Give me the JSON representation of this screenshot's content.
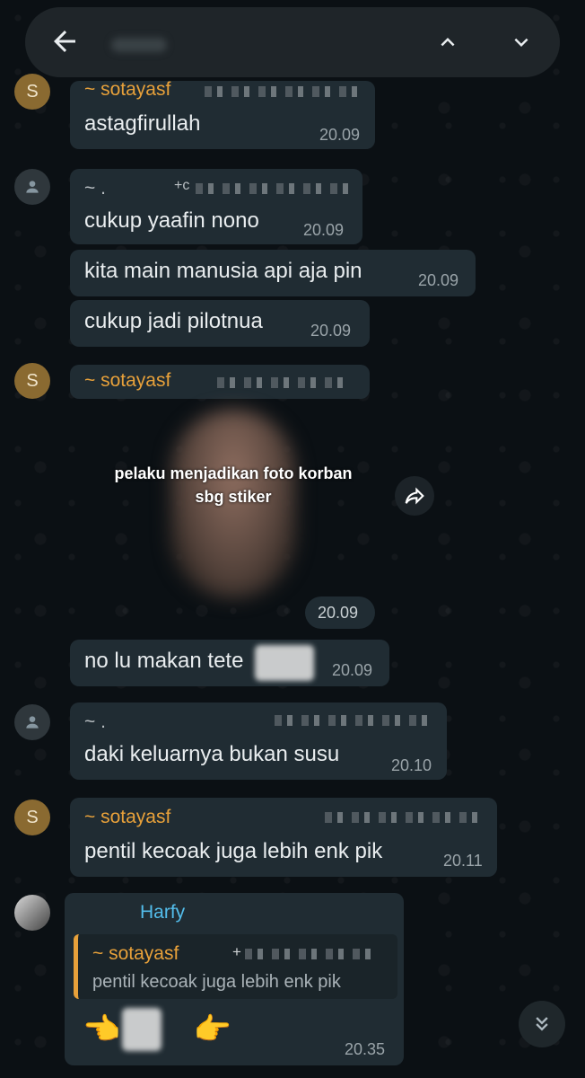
{
  "header": {
    "back_label": "back",
    "nav_up": "previous",
    "nav_down": "next"
  },
  "messages": [
    {
      "sender": "~ sotayasf",
      "text": "astagfirullah",
      "time": "20.09"
    },
    {
      "sender": "~ .",
      "sender_extra": "+c",
      "text": "cukup yaafin nono",
      "time": "20.09"
    },
    {
      "text": "kita main manusia api aja pin",
      "time": "20.09"
    },
    {
      "text": "cukup jadi pilotnua",
      "time": "20.09"
    },
    {
      "sender": "~ sotayasf",
      "sticker_caption": "pelaku menjadikan foto korban sbg stiker",
      "time": "20.09"
    },
    {
      "text": "no lu makan tete",
      "time": "20.09"
    },
    {
      "sender": "~ .",
      "text": "daki keluarnya bukan susu",
      "time": "20.10"
    },
    {
      "sender": "~ sotayasf",
      "text": "pentil kecoak juga lebih enk pik",
      "time": "20.11"
    },
    {
      "sender": "Harfy",
      "reply_to": {
        "sender": "~ sotayasf",
        "phone_prefix": "+",
        "text": "pentil kecoak juga lebih enk pik"
      },
      "text": "👈 👉",
      "time": "20.35"
    }
  ],
  "avatars": {
    "s_letter": "S"
  },
  "colors": {
    "bubble": "#202c33",
    "accent_orange": "#e8a13a",
    "harfy_blue": "#53bdeb",
    "background": "#0b1014"
  },
  "icons": {
    "back": "arrow-left-icon",
    "up": "chevron-up-icon",
    "down": "chevron-down-icon",
    "forward": "forward-icon",
    "scroll": "double-chevron-down-icon"
  }
}
